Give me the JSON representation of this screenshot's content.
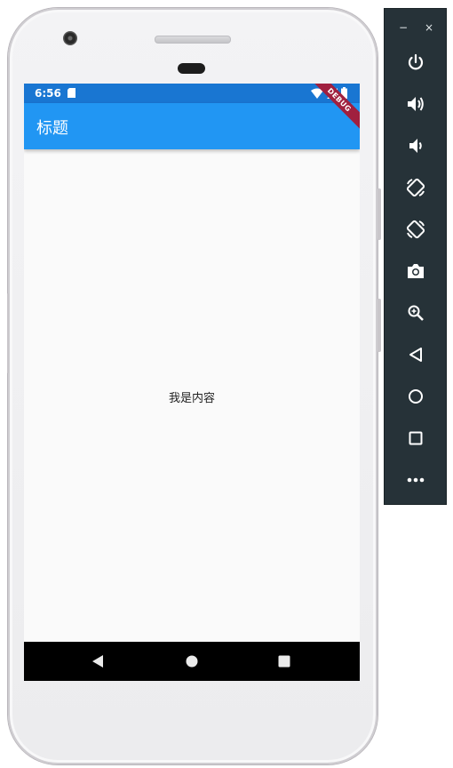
{
  "status_bar": {
    "time": "6:56",
    "icons": [
      "sd-card-icon",
      "wifi-icon",
      "signal-icon",
      "battery-icon"
    ]
  },
  "app_bar": {
    "title": "标题",
    "debug_banner": "DEBUG"
  },
  "content": {
    "text": "我是内容"
  },
  "nav_bar": {
    "buttons": [
      "back-icon",
      "home-icon",
      "recents-icon"
    ]
  },
  "emulator_panel": {
    "window_controls": {
      "minimize": "−",
      "close": "×"
    },
    "tools": [
      "power-icon",
      "volume-up-icon",
      "volume-down-icon",
      "rotate-left-icon",
      "rotate-right-icon",
      "camera-icon",
      "zoom-icon",
      "back-icon",
      "home-icon",
      "overview-icon",
      "more-icon"
    ]
  },
  "colors": {
    "status_bar": "#1976d2",
    "app_bar": "#2196f3",
    "screen_bg": "#fafafa",
    "panel_bg": "#263238",
    "debug_banner": "#a0203f"
  }
}
